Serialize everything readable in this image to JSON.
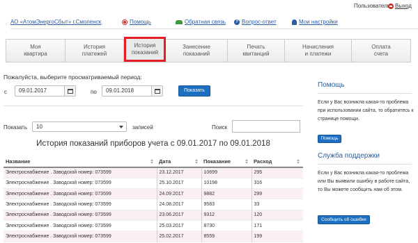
{
  "userbar": {
    "user_label": "Пользователь:",
    "exit_label": "Выход"
  },
  "links": {
    "company": "АО «АтомЭнергоСбыт» г.Смоленск",
    "help": "Помощь",
    "feedback": "Обратная связь",
    "faq": "Вопрос-ответ",
    "settings": "Мои настройки"
  },
  "tabs": [
    {
      "line1": "Моя",
      "line2": "квартира",
      "active": false
    },
    {
      "line1": "История",
      "line2": "платежей",
      "active": false
    },
    {
      "line1": "История",
      "line2": "показаний",
      "active": true
    },
    {
      "line1": "Занесение",
      "line2": "показаний",
      "active": false
    },
    {
      "line1": "Печать",
      "line2": "квитанций",
      "active": false
    },
    {
      "line1": "Начисления",
      "line2": "и платежи",
      "active": false
    },
    {
      "line1": "Оплата",
      "line2": "счета",
      "active": false
    }
  ],
  "period": {
    "title": "Пожалуйста, выберите просматриваемый период:",
    "from_label": "с",
    "from_value": "09.01.2017",
    "to_label": "по",
    "to_value": "09.01.2018",
    "show_button": "Показать"
  },
  "table_controls": {
    "show_label": "Показать",
    "page_size": "10",
    "records_label": "записей",
    "search_label": "Поиск"
  },
  "readings": {
    "title": "История показаний приборов учета с 09.01.2017 по 09.01.2018",
    "columns": [
      "Название",
      "Дата",
      "Показание",
      "Расход"
    ],
    "rows": [
      [
        "Электроснабжение . Заводской номер: 073599",
        "23.12.2017",
        "10699",
        "295"
      ],
      [
        "Электроснабжение . Заводской номер: 073599",
        "25.10.2017",
        "10198",
        "316"
      ],
      [
        "Электроснабжение . Заводской номер: 073599",
        "24.09.2017",
        "9882",
        "299"
      ],
      [
        "Электроснабжение . Заводской номер: 073599",
        "24.08.2017",
        "9583",
        "33"
      ],
      [
        "Электроснабжение . Заводской номер: 073599",
        "23.06.2017",
        "9312",
        "120"
      ],
      [
        "Электроснабжение . Заводской номер: 073599",
        "25.03.2017",
        "8730",
        "171"
      ],
      [
        "Электроснабжение . Заводской номер: 073599",
        "25.02.2017",
        "8559",
        "199"
      ]
    ]
  },
  "sidebar": {
    "help_title": "Помощь",
    "help_text": "Если у Вас возникла какая-то проблема при использовании сайта, то обратитесь к странице помощи.",
    "help_button": "Помощь",
    "support_title": "Служба поддержки",
    "support_text": "Если у Вас возникла какая-то проблема или Вы выявили ошибку в работе сайта, то Вы можете сообщить нам об этом.",
    "report_button": "Сообщить об ошибке"
  },
  "colors": {
    "accent": "#1e6fbf",
    "link": "#2a5d9f",
    "active_tab_border": "#e31e24"
  }
}
